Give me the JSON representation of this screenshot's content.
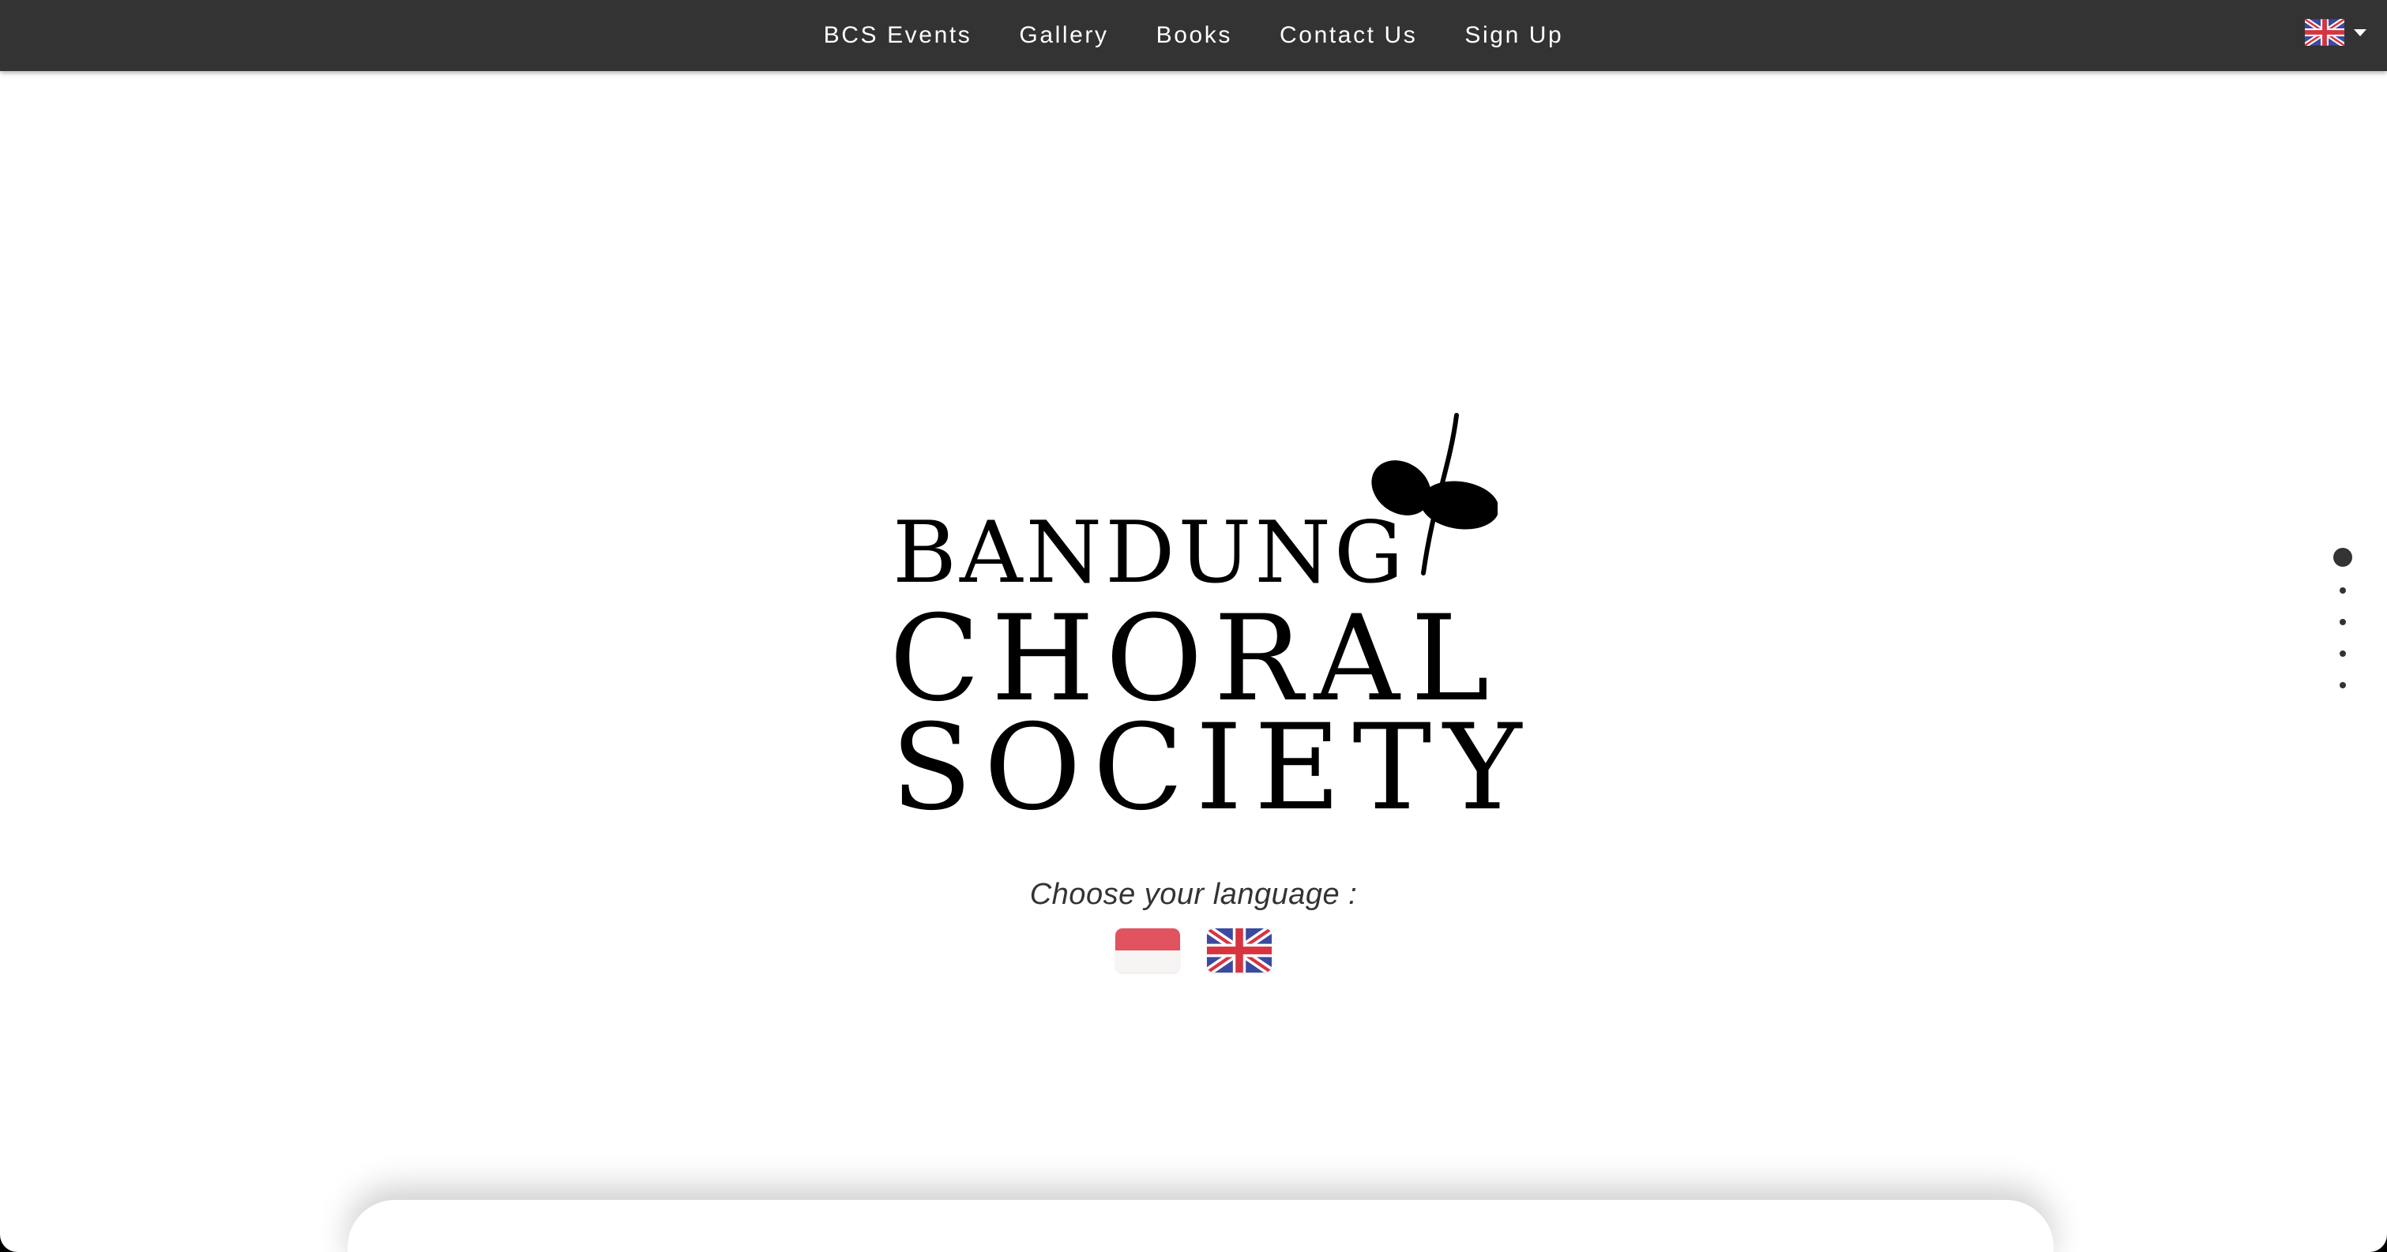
{
  "nav": {
    "items": [
      {
        "label": "BCS Events"
      },
      {
        "label": "Gallery"
      },
      {
        "label": "Books"
      },
      {
        "label": "Contact Us"
      },
      {
        "label": "Sign Up"
      }
    ],
    "language_switch": {
      "icon": "uk-flag-icon"
    }
  },
  "hero": {
    "logo": {
      "line1": "BANDUNG",
      "line2": "CHORAL",
      "line3": "SOCIETY",
      "icon": "leaf-sprout-icon"
    },
    "choose_language": "Choose your language :",
    "languages": [
      {
        "code": "id",
        "icon": "indonesia-flag-icon"
      },
      {
        "code": "en",
        "icon": "uk-flag-icon"
      }
    ]
  },
  "section_dots": {
    "count": 5,
    "active_index": 0
  },
  "colors": {
    "navbar_bg": "#333333",
    "nav_text": "#ffffff",
    "page_bg": "#ffffff",
    "logo": "#000000",
    "flag_red": "#e0535f",
    "uk_blue": "#3b4aa0",
    "uk_red": "#d6343f"
  }
}
